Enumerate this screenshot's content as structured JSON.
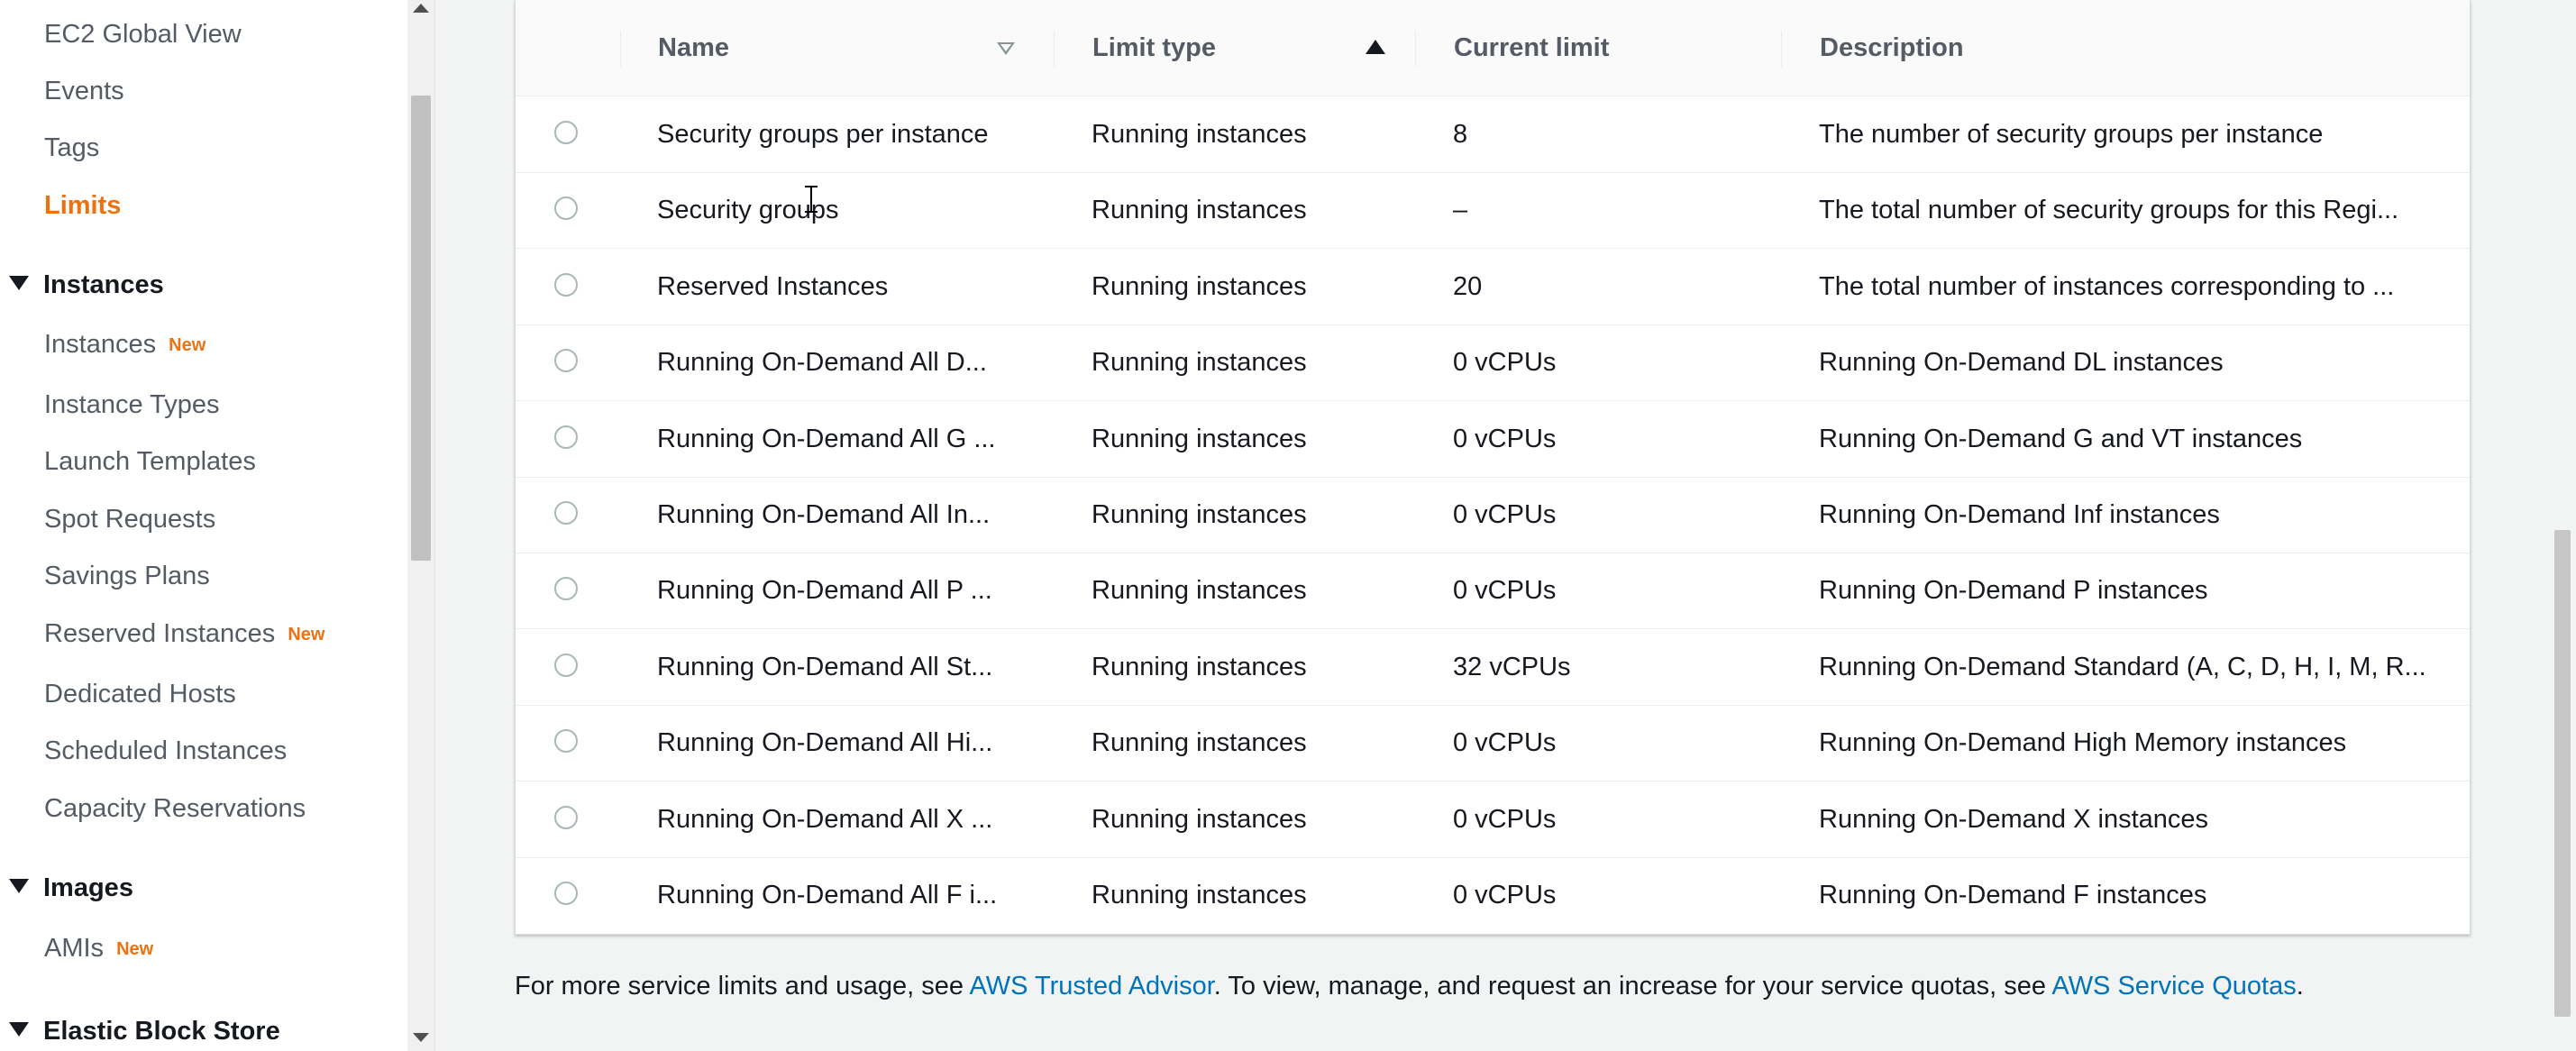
{
  "sidebar": {
    "items_top": [
      {
        "label": "EC2 Global View"
      },
      {
        "label": "Events"
      },
      {
        "label": "Tags"
      },
      {
        "label": "Limits",
        "active": true
      }
    ],
    "instances_section": {
      "title": "Instances",
      "items": [
        {
          "label": "Instances",
          "badge": "New"
        },
        {
          "label": "Instance Types"
        },
        {
          "label": "Launch Templates"
        },
        {
          "label": "Spot Requests"
        },
        {
          "label": "Savings Plans"
        },
        {
          "label": "Reserved Instances",
          "badge": "New"
        },
        {
          "label": "Dedicated Hosts"
        },
        {
          "label": "Scheduled Instances"
        },
        {
          "label": "Capacity Reservations"
        }
      ]
    },
    "images_section": {
      "title": "Images",
      "items": [
        {
          "label": "AMIs",
          "badge": "New"
        }
      ]
    },
    "ebs_section": {
      "title": "Elastic Block Store"
    }
  },
  "table": {
    "columns": {
      "name": "Name",
      "limit_type": "Limit type",
      "current_limit": "Current limit",
      "description": "Description"
    },
    "rows": [
      {
        "name": "Security groups per instance",
        "limit_type": "Running instances",
        "current_limit": "8",
        "description": "The number of security groups per instance"
      },
      {
        "name": "Security groups",
        "limit_type": "Running instances",
        "current_limit": "–",
        "description": "The total number of security groups for this Regi..."
      },
      {
        "name": "Reserved Instances",
        "limit_type": "Running instances",
        "current_limit": "20",
        "description": "The total number of instances corresponding to ..."
      },
      {
        "name": "Running On-Demand All D...",
        "limit_type": "Running instances",
        "current_limit": "0 vCPUs",
        "description": "Running On-Demand DL instances"
      },
      {
        "name": "Running On-Demand All G ...",
        "limit_type": "Running instances",
        "current_limit": "0 vCPUs",
        "description": "Running On-Demand G and VT instances"
      },
      {
        "name": "Running On-Demand All In...",
        "limit_type": "Running instances",
        "current_limit": "0 vCPUs",
        "description": "Running On-Demand Inf instances"
      },
      {
        "name": "Running On-Demand All P ...",
        "limit_type": "Running instances",
        "current_limit": "0 vCPUs",
        "description": "Running On-Demand P instances"
      },
      {
        "name": "Running On-Demand All St...",
        "limit_type": "Running instances",
        "current_limit": "32 vCPUs",
        "description": "Running On-Demand Standard (A, C, D, H, I, M, R..."
      },
      {
        "name": "Running On-Demand All Hi...",
        "limit_type": "Running instances",
        "current_limit": "0 vCPUs",
        "description": "Running On-Demand High Memory instances"
      },
      {
        "name": "Running On-Demand All X ...",
        "limit_type": "Running instances",
        "current_limit": "0 vCPUs",
        "description": "Running On-Demand X instances"
      },
      {
        "name": "Running On-Demand All F i...",
        "limit_type": "Running instances",
        "current_limit": "0 vCPUs",
        "description": "Running On-Demand F instances"
      }
    ]
  },
  "footer": {
    "text_1": "For more service limits and usage, see ",
    "link_1": "AWS Trusted Advisor",
    "text_2": ". To view, manage, and request an increase for your service quotas, see ",
    "link_2": "AWS Service Quotas",
    "text_3": "."
  },
  "colors": {
    "accent_orange": "#ec7211",
    "link_blue": "#0073bb",
    "text": "#16191f",
    "muted": "#545b64"
  }
}
